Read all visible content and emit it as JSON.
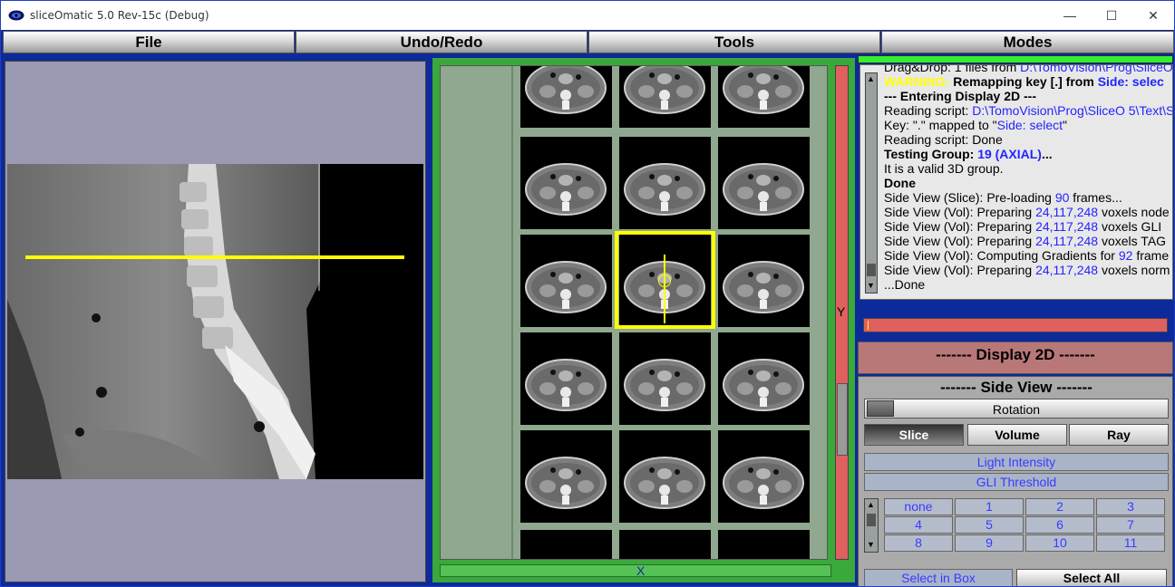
{
  "window": {
    "title": "sliceOmatic 5.0 Rev-15c (Debug)",
    "min_glyph": "—",
    "max_glyph": "☐",
    "close_glyph": "✕"
  },
  "menu": [
    "File",
    "Undo/Redo",
    "Tools",
    "Modes"
  ],
  "grid": {
    "y_axis_label": "Y",
    "x_axis_label": "X"
  },
  "log": {
    "lines": [
      [
        {
          "t": "Drag&Drop: 1 files from "
        },
        {
          "t": "D:\\TomoVision\\Prog\\SliceO",
          "c": "blue"
        }
      ],
      [
        {
          "t": "WARNING:",
          "c": "warn"
        },
        {
          "t": " Remapping key [.] from ",
          "c": "bold"
        },
        {
          "t": "Side: selec",
          "c": "blue bold"
        }
      ],
      [
        {
          "t": " --- Entering Display 2D ---",
          "c": "bold"
        }
      ],
      [
        {
          "t": "Reading script: "
        },
        {
          "t": "D:\\TomoVision\\Prog\\SliceO 5\\Text\\S",
          "c": "blue"
        }
      ],
      [
        {
          "t": "Key: \".\" mapped to \""
        },
        {
          "t": "Side: select",
          "c": "blue"
        },
        {
          "t": "\""
        }
      ],
      [
        {
          "t": "Reading script: Done"
        }
      ],
      [
        {
          "t": "Testing Group: ",
          "c": "bold"
        },
        {
          "t": "19 (AXIAL)",
          "c": "blue bold"
        },
        {
          "t": "...",
          "c": "bold"
        }
      ],
      [
        {
          "t": "    It is a valid 3D group."
        }
      ],
      [
        {
          "t": "Done",
          "c": "bold"
        }
      ],
      [
        {
          "t": "Side View (Slice): Pre-loading "
        },
        {
          "t": "90",
          "c": "blue"
        },
        {
          "t": " frames..."
        }
      ],
      [
        {
          "t": "Side View (Vol): Preparing "
        },
        {
          "t": "24,117,248",
          "c": "blue"
        },
        {
          "t": " voxels node"
        }
      ],
      [
        {
          "t": "Side View (Vol): Preparing "
        },
        {
          "t": "24,117,248",
          "c": "blue"
        },
        {
          "t": " voxels GLI"
        }
      ],
      [
        {
          "t": "Side View (Vol): Preparing "
        },
        {
          "t": "24,117,248",
          "c": "blue"
        },
        {
          "t": " voxels TAG"
        }
      ],
      [
        {
          "t": "Side View (Vol): Computing Gradients for "
        },
        {
          "t": "92",
          "c": "blue"
        },
        {
          "t": " frame"
        }
      ],
      [
        {
          "t": "Side View (Vol):  Preparing "
        },
        {
          "t": "24,117,248",
          "c": "blue"
        },
        {
          "t": " voxels norm"
        }
      ],
      [
        {
          "t": "...Done"
        }
      ]
    ]
  },
  "display2d": {
    "title": "------- Display 2D -------"
  },
  "sideview": {
    "title": "------- Side View -------",
    "rotation_label": "Rotation",
    "tabs": [
      "Slice",
      "Volume",
      "Ray"
    ],
    "active_tab": "Slice",
    "light_intensity": "Light Intensity",
    "gli_threshold": "GLI Threshold",
    "tag_buttons": [
      "none",
      "1",
      "2",
      "3",
      "4",
      "5",
      "6",
      "7",
      "8",
      "9",
      "10",
      "11"
    ],
    "select_in_box": "Select in Box",
    "select_all": "Select All"
  },
  "colors": {
    "window_frame": "#0c2a9a",
    "grid_background": "#3aa83a",
    "highlight": "#ffff00",
    "progress": "#33ee33",
    "scroll_red": "#e06060"
  }
}
